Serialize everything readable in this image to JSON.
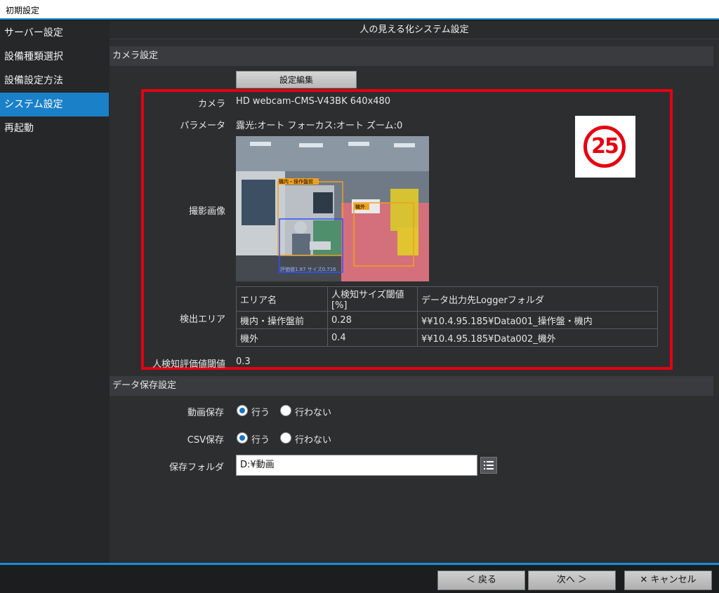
{
  "window": {
    "title": "初期設定"
  },
  "sidebar": {
    "items": [
      {
        "label": "サーバー設定"
      },
      {
        "label": "設備種類選択"
      },
      {
        "label": "設備設定方法"
      },
      {
        "label": "システム設定",
        "active": true
      },
      {
        "label": "再起動"
      }
    ]
  },
  "main": {
    "title": "人の見える化システム設定",
    "camera_section": {
      "header": "カメラ設定",
      "edit_button": "設定編集",
      "camera_label": "カメラ",
      "camera_value": "HD webcam-CMS-V43BK 640x480",
      "param_label": "パラメータ",
      "param_value": "露光:オート フォーカス:オート ズーム:0",
      "image_label": "撮影画像",
      "image_overlays": [
        "機内・操作盤前",
        "機外",
        "評価値1.87 サイズ0.716"
      ],
      "badge": "25",
      "detect_label": "検出エリア",
      "table": {
        "headers": [
          "エリア名",
          "人検知サイズ閾値[%]",
          "データ出力先Loggerフォルダ"
        ],
        "rows": [
          [
            "機内・操作盤前",
            "0.28",
            "¥¥10.4.95.185¥Data001_操作盤・機内"
          ],
          [
            "機外",
            "0.4",
            "¥¥10.4.95.185¥Data002_機外"
          ]
        ]
      },
      "threshold_label": "人検知評価値閾値",
      "threshold_value": "0.3"
    },
    "data_section": {
      "header": "データ保存設定",
      "video_label": "動画保存",
      "csv_label": "CSV保存",
      "opt_yes": "行う",
      "opt_no": "行わない",
      "video_selected": "行う",
      "csv_selected": "行う",
      "folder_label": "保存フォルダ",
      "folder_value": "D:¥動画"
    }
  },
  "footer": {
    "back": "＜ 戻る",
    "next": "次へ ＞",
    "cancel": "✕ キャンセル"
  },
  "colors": {
    "accent": "#1a8fd6",
    "highlight_box": "#e60012",
    "active_item": "#1a80c8"
  }
}
